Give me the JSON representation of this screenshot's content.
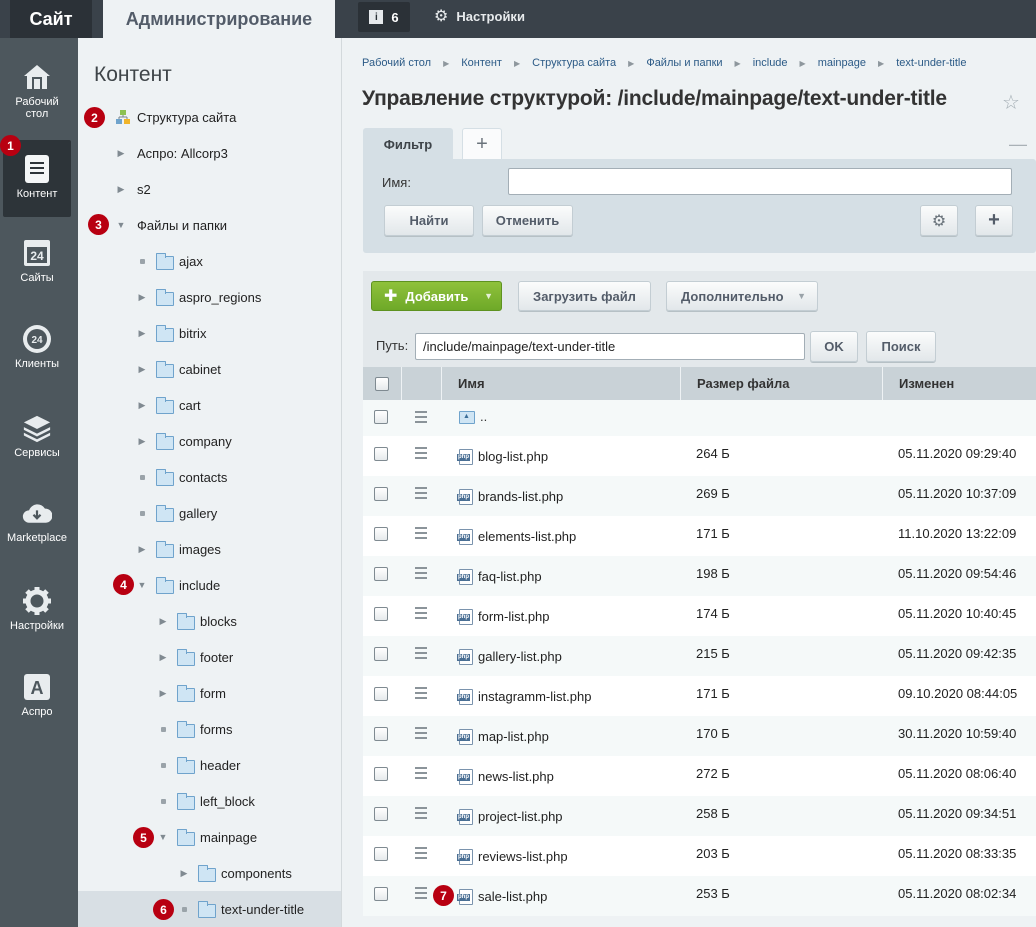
{
  "topbar": {
    "site_tab": "Сайт",
    "admin_tab": "Администрирование",
    "notifications_count": "6",
    "settings_label": "Настройки"
  },
  "iconbar": {
    "items": [
      {
        "label": "Рабочий стол",
        "icon": "home-icon"
      },
      {
        "label": "Контент",
        "icon": "document-icon",
        "active": true
      },
      {
        "label": "Сайты",
        "icon": "calendar-24-icon"
      },
      {
        "label": "Клиенты",
        "icon": "clients-24-icon"
      },
      {
        "label": "Сервисы",
        "icon": "layers-icon"
      },
      {
        "label": "Marketplace",
        "icon": "cloud-download-icon"
      },
      {
        "label": "Настройки",
        "icon": "gear-icon"
      },
      {
        "label": "Аспро",
        "icon": "letter-a-icon"
      }
    ]
  },
  "tree": {
    "title": "Контент",
    "items": [
      {
        "label": "Структура сайта",
        "level": 0
      },
      {
        "label": "Аспро: Allcorp3",
        "level": 1
      },
      {
        "label": "s2",
        "level": 1
      },
      {
        "label": "Файлы и папки",
        "level": 1
      },
      {
        "label": "ajax",
        "level": 2
      },
      {
        "label": "aspro_regions",
        "level": 2
      },
      {
        "label": "bitrix",
        "level": 2
      },
      {
        "label": "cabinet",
        "level": 2
      },
      {
        "label": "cart",
        "level": 2
      },
      {
        "label": "company",
        "level": 2
      },
      {
        "label": "contacts",
        "level": 2
      },
      {
        "label": "gallery",
        "level": 2
      },
      {
        "label": "images",
        "level": 2
      },
      {
        "label": "include",
        "level": 2
      },
      {
        "label": "blocks",
        "level": 3
      },
      {
        "label": "footer",
        "level": 3
      },
      {
        "label": "form",
        "level": 3
      },
      {
        "label": "forms",
        "level": 3
      },
      {
        "label": "header",
        "level": 3
      },
      {
        "label": "left_block",
        "level": 3
      },
      {
        "label": "mainpage",
        "level": 3
      },
      {
        "label": "components",
        "level": 4
      },
      {
        "label": "text-under-title",
        "level": 4
      }
    ]
  },
  "badges": [
    "1",
    "2",
    "3",
    "4",
    "5",
    "6",
    "7"
  ],
  "breadcrumb": [
    "Рабочий стол",
    "Контент",
    "Структура сайта",
    "Файлы и папки",
    "include",
    "mainpage",
    "text-under-title"
  ],
  "page_title": "Управление структурой: /include/mainpage/text-under-title",
  "filter": {
    "tab_label": "Фильтр",
    "add_tab": "+",
    "name_label": "Имя:",
    "name_value": "",
    "find_button": "Найти",
    "cancel_button": "Отменить"
  },
  "toolbar": {
    "add_button": "Добавить",
    "upload_button": "Загрузить файл",
    "more_button": "Дополнительно"
  },
  "path": {
    "label": "Путь:",
    "value": "/include/mainpage/text-under-title",
    "ok_button": "OK",
    "search_button": "Поиск"
  },
  "table": {
    "headers": {
      "name": "Имя",
      "size": "Размер файла",
      "modified": "Изменен"
    },
    "up_label": "..",
    "rows": [
      {
        "name": "blog-list.php",
        "size": "264 Б",
        "modified": "05.11.2020 09:29:40"
      },
      {
        "name": "brands-list.php",
        "size": "269 Б",
        "modified": "05.11.2020 10:37:09"
      },
      {
        "name": "elements-list.php",
        "size": "171 Б",
        "modified": "11.10.2020 13:22:09"
      },
      {
        "name": "faq-list.php",
        "size": "198 Б",
        "modified": "05.11.2020 09:54:46"
      },
      {
        "name": "form-list.php",
        "size": "174 Б",
        "modified": "05.11.2020 10:40:45"
      },
      {
        "name": "gallery-list.php",
        "size": "215 Б",
        "modified": "05.11.2020 09:42:35"
      },
      {
        "name": "instagramm-list.php",
        "size": "171 Б",
        "modified": "09.10.2020 08:44:05"
      },
      {
        "name": "map-list.php",
        "size": "170 Б",
        "modified": "30.11.2020 10:59:40"
      },
      {
        "name": "news-list.php",
        "size": "272 Б",
        "modified": "05.11.2020 08:06:40"
      },
      {
        "name": "project-list.php",
        "size": "258 Б",
        "modified": "05.11.2020 09:34:51"
      },
      {
        "name": "reviews-list.php",
        "size": "203 Б",
        "modified": "05.11.2020 08:33:35"
      },
      {
        "name": "sale-list.php",
        "size": "253 Б",
        "modified": "05.11.2020 08:02:34"
      }
    ]
  }
}
